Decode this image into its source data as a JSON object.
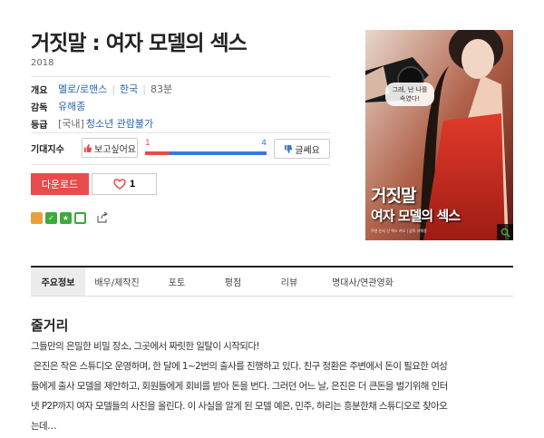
{
  "movie": {
    "title": "거짓말 : 여자 모델의 섹스",
    "year": "2018",
    "overview_label": "개요",
    "genre": "멜로/로맨스",
    "country": "한국",
    "runtime": "83분",
    "director_label": "감독",
    "director": "유해종",
    "rating_label": "등급",
    "rating_prefix": "[국내]",
    "rating": "청소년 관람불가"
  },
  "expect": {
    "label": "기대지수",
    "want_label": "보고싶어요",
    "want_count": "1",
    "meh_count": "4",
    "meh_label": "글쎄요",
    "want_fraction": 0.2
  },
  "actions": {
    "download_label": "다운로드",
    "like_count": "1"
  },
  "poster": {
    "speech": "그래, 난 나를\n속였다!",
    "title_line1": "거짓말",
    "title_line2": "여자 모델의 섹스",
    "credit": "주연 은지 신 엑스 카오 | 감독 유해종"
  },
  "tabs": [
    "주요정보",
    "배우/제작진",
    "포토",
    "평점",
    "리뷰",
    "명대사/연관영화"
  ],
  "synopsis": {
    "heading": "줄거리",
    "lines": [
      "그들만의 은밀한 비밀 장소, 그곳에서 짜릿한 일탈이 시작되다!",
      " 은진은 작은 스튜디오 운영하며, 한 달에 1~2번의 출사를 진행하고 있다. 친구 정환은 주변에서 돈이 필요한 여성",
      "들에게 출사 모델을 제안하고, 회원들에게 회비를 받아 돈을 번다. 그러던 어느 날, 은진은 더 큰돈을 벌기위해 인터",
      "넷 P2P까지 여자 모델들의 사진을 올린다. 이 사실을 알게 된 모델 예은, 민주, 하리는 흥분한채 스튜디오로 찾아오",
      "는데…"
    ]
  },
  "colors": {
    "accent_red": "#e84b4b",
    "accent_blue": "#3b79d8",
    "link": "#2a64b0"
  }
}
